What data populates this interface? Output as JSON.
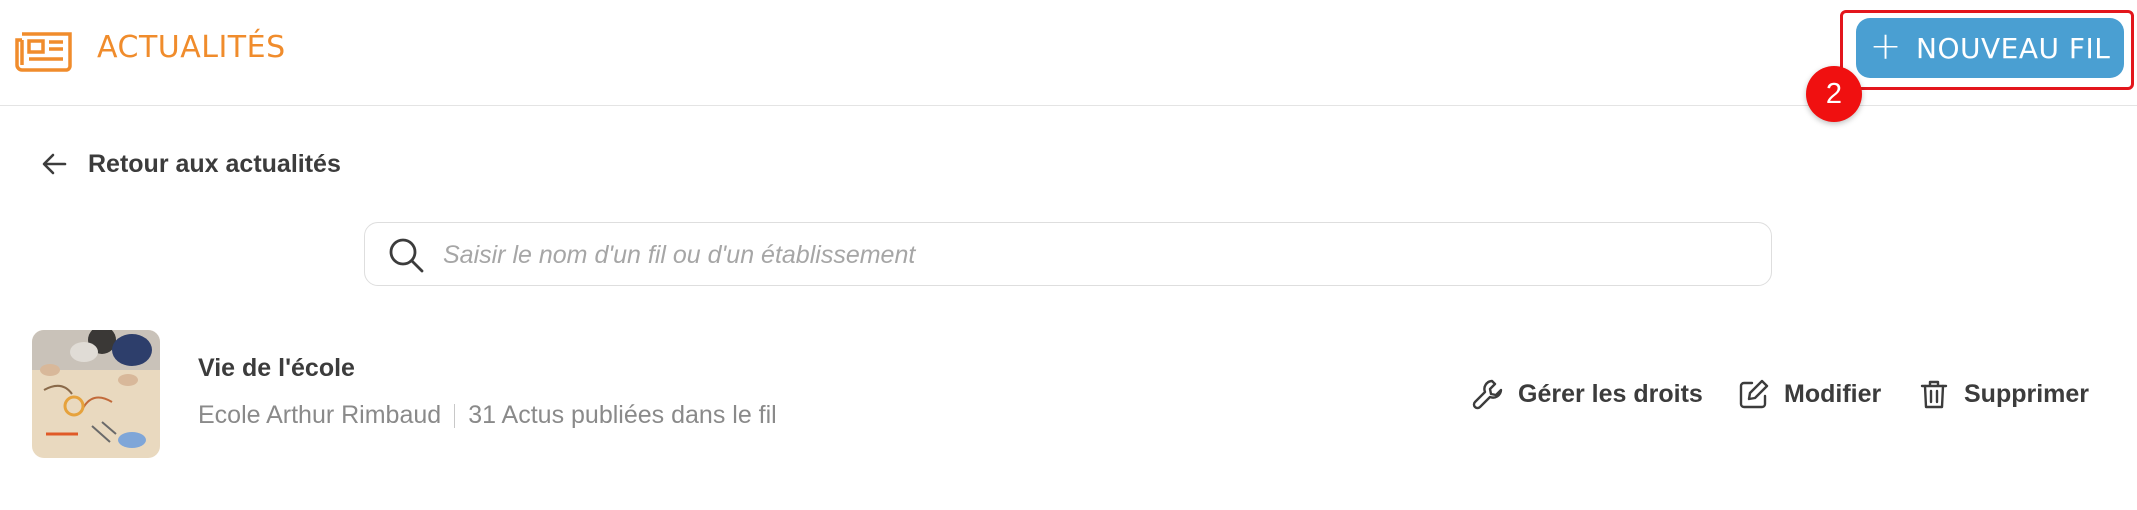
{
  "header": {
    "app_title": "ACTUALITÉS",
    "app_icon": "newspaper-icon",
    "new_button": {
      "label": "NOUVEAU FIL",
      "icon": "plus-icon"
    },
    "step_badge": "2",
    "accent_color": "#f08c2c",
    "button_color": "#4a9fd2",
    "highlight_color": "#e3161c"
  },
  "back_link": {
    "label": "Retour aux actualités",
    "icon": "arrow-left-icon"
  },
  "search": {
    "placeholder": "Saisir le nom d'un fil ou d'un établissement",
    "value": "",
    "icon": "search-icon"
  },
  "threads": [
    {
      "title": "Vie de l'école",
      "school": "Ecole Arthur Rimbaud",
      "count_text": "31 Actus publiées dans le fil",
      "actions": [
        {
          "label": "Gérer les droits",
          "icon": "wrench-icon"
        },
        {
          "label": "Modifier",
          "icon": "edit-icon"
        },
        {
          "label": "Supprimer",
          "icon": "trash-icon"
        }
      ]
    }
  ]
}
